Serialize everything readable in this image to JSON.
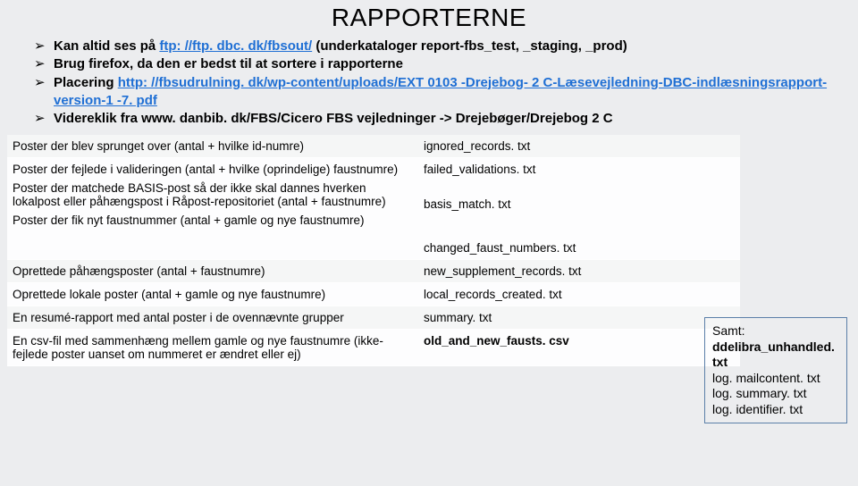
{
  "title": "RAPPORTERNE",
  "bullets": [
    {
      "pre": "Kan altid ses på ",
      "link": "ftp: //ftp. dbc. dk/fbsout/",
      "post": " (underkataloger report-fbs_test, _staging, _prod)"
    },
    {
      "pre": "Brug firefox, da den er bedst til at sortere i rapporterne",
      "link": "",
      "post": ""
    },
    {
      "pre": "Placering ",
      "link": "http: //fbsudrulning. dk/wp-content/uploads/EXT 0103 -Drejebog- 2 C-Læsevejledning-DBC-indlæsningsrapport-version-1 -7. pdf",
      "post": ""
    },
    {
      "pre": "Videreklik fra www. danbib. dk/FBS/Cicero FBS vejledninger -> Drejebøger/Drejebog 2 C",
      "link": "",
      "post": ""
    }
  ],
  "rows": [
    {
      "left": [
        "Poster der blev sprunget over (antal + hvilke id-numre)"
      ],
      "right": [
        "ignored_records. txt"
      ]
    },
    {
      "left": [
        "Poster der fejlede i valideringen (antal + hvilke (oprindelige) faustnumre)",
        "Poster der matchede BASIS-post så der ikke skal dannes hverken lokalpost eller påhængspost i Råpost-repositoriet (antal + faustnumre)",
        "Poster der fik nyt faustnummer (antal + gamle og nye faustnumre)"
      ],
      "right": [
        "failed_validations. txt",
        "basis_match. txt",
        "changed_faust_numbers. txt"
      ]
    },
    {
      "left": [
        "Oprettede påhængsposter (antal + faustnumre)"
      ],
      "right": [
        "new_supplement_records. txt"
      ]
    },
    {
      "left": [
        "Oprettede lokale poster (antal + gamle og nye faustnumre)"
      ],
      "right": [
        "local_records_created. txt"
      ]
    },
    {
      "left": [
        "En resumé-rapport med antal poster i de ovennævnte grupper"
      ],
      "right": [
        "summary. txt"
      ]
    },
    {
      "left": [
        "En csv-fil med sammenhæng mellem gamle og nye faustnumre (ikke-fejlede poster uanset om nummeret er ændret eller ej)"
      ],
      "right": [
        "old_and_new_fausts. csv"
      ]
    }
  ],
  "sidebox": {
    "head": "Samt:",
    "lines": [
      "ddelibra_unhandled. txt",
      "log. mailcontent. txt",
      "log. summary. txt",
      "log. identifier. txt"
    ]
  }
}
